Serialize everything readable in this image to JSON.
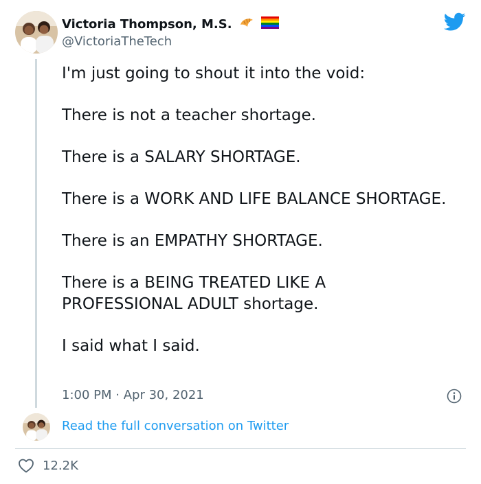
{
  "author": {
    "display_name": "Victoria Thompson, M.S.",
    "handle": "@VictoriaTheTech",
    "badges": [
      "croissant-emoji",
      "rainbow-flag-emoji"
    ]
  },
  "tweet": {
    "paragraphs": [
      "I'm just going to shout it into the void:",
      "There is not a teacher shortage.",
      "There is a SALARY SHORTAGE.",
      "There is a WORK AND LIFE BALANCE SHORTAGE.",
      "There is an EMPATHY SHORTAGE.",
      "There is a BEING TREATED LIKE A PROFESSIONAL ADULT shortage.",
      "I said what I said."
    ],
    "time": "1:00 PM",
    "separator": "·",
    "date": "Apr 30, 2021"
  },
  "links": {
    "full_conversation": "Read the full conversation on Twitter"
  },
  "engagement": {
    "likes": "12.2K"
  },
  "colors": {
    "twitter_blue": "#1d9bf0",
    "text_primary": "#0f1419",
    "text_secondary": "#536471",
    "divider": "#cfd9de"
  },
  "icons": [
    "twitter-logo-icon",
    "info-icon",
    "heart-icon"
  ]
}
